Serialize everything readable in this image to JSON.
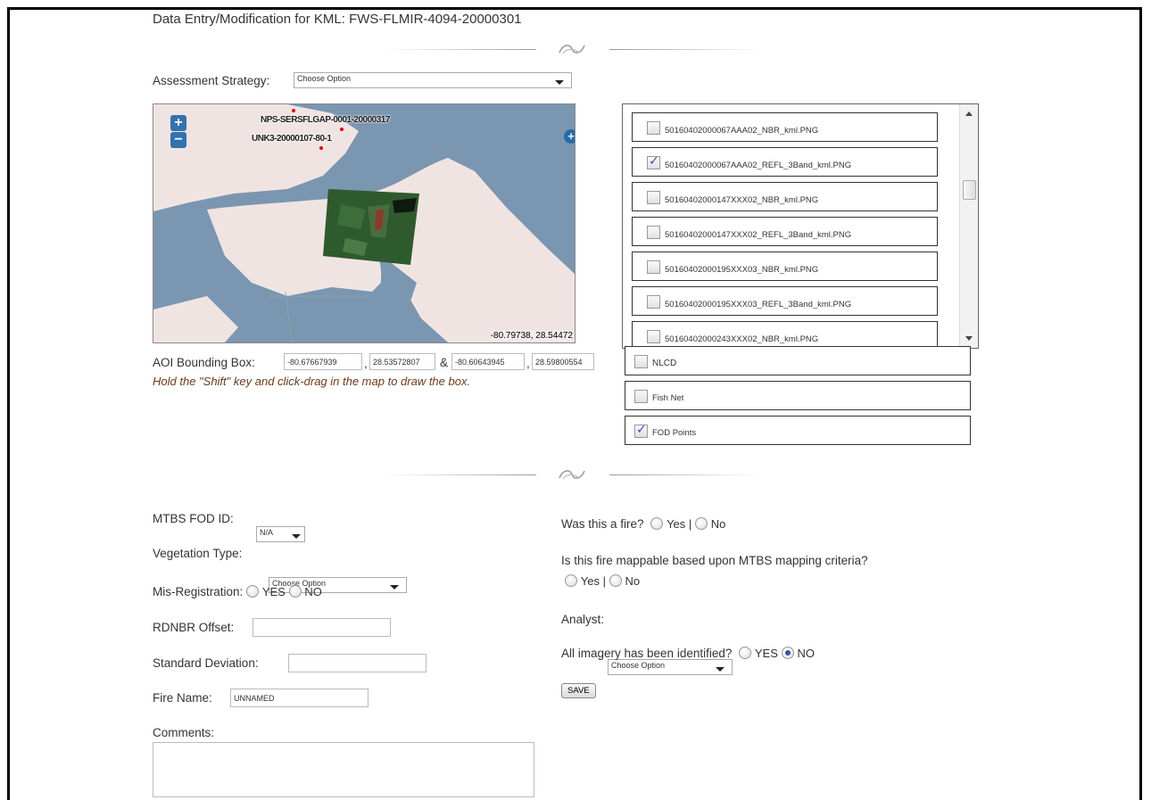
{
  "header": {
    "title": "Data Entry/Modification for KML: FWS-FLMIR-4094-20000301"
  },
  "assessment": {
    "label": "Assessment Strategy:",
    "value": "Choose Option"
  },
  "map": {
    "zoom_in": "+",
    "zoom_out": "−",
    "layer_switch": "+",
    "label_1": "NPS-SERSFLGAP-0001-20000317",
    "label_2": "UNK3-20000107-80-1",
    "coords": "-80.79738, 28.54472",
    "colors": {
      "water": "#7b96b0",
      "land": "#f0e4e2",
      "image": "#2f5a2e"
    }
  },
  "imagery": {
    "items": [
      {
        "name": "50160402000067AAA02_NBR_kml.PNG",
        "checked": false
      },
      {
        "name": "50160402000067AAA02_REFL_3Band_kml.PNG",
        "checked": true
      },
      {
        "name": "50160402000147XXX02_NBR_kml.PNG",
        "checked": false
      },
      {
        "name": "50160402000147XXX02_REFL_3Band_kml.PNG",
        "checked": false
      },
      {
        "name": "50160402000195XXX03_NBR_kml.PNG",
        "checked": false
      },
      {
        "name": "50160402000195XXX03_REFL_3Band_kml.PNG",
        "checked": false
      },
      {
        "name": "50160402000243XXX02_NBR_kml.PNG",
        "checked": false
      }
    ]
  },
  "layers": [
    {
      "name": "NLCD",
      "checked": false
    },
    {
      "name": "Fish Net",
      "checked": false
    },
    {
      "name": "FOD Points",
      "checked": true
    }
  ],
  "aoi": {
    "label": "AOI Bounding Box:",
    "v1": "-80.67667939",
    "v2": "28.53572807",
    "sep_comma": ",",
    "sep_and": "&",
    "v3": "-80.60643945",
    "v4": "28.59800554",
    "hint": "Hold the \"Shift\" key and click-drag in the map to draw the box."
  },
  "form": {
    "fod_label": "MTBS FOD ID:",
    "fod_value": "N/A",
    "veg_label": "Vegetation Type:",
    "veg_value": "Choose Option",
    "misreg_label": "Mis-Registration:",
    "misreg_yes": "YES",
    "misreg_no": "NO",
    "rdnbr_label": "RDNBR Offset:",
    "rdnbr_value": "",
    "stddev_label": "Standard Deviation:",
    "stddev_value": "",
    "fire_name_label": "Fire Name:",
    "fire_name_value": "UNNAMED",
    "comments_label": "Comments:",
    "comments_value": "",
    "was_fire_label": "Was this a fire?",
    "yes": "Yes |",
    "no": "No",
    "mappable_label": "Is this fire mappable based upon MTBS mapping criteria?",
    "analyst_label": "Analyst:",
    "analyst_value": "Choose Option",
    "imagery_id_label": "All imagery has been identified?",
    "imagery_yes": "YES",
    "imagery_no": "NO",
    "save": "SAVE"
  }
}
